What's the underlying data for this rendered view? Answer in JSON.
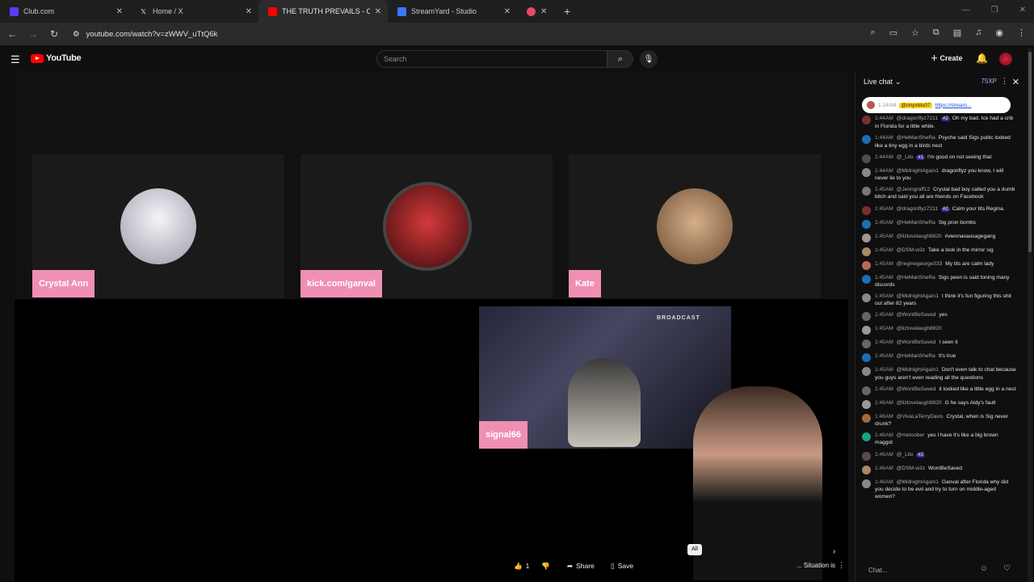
{
  "browser": {
    "tabs": [
      {
        "title": "Club.com",
        "icon_color": "#5b3cff"
      },
      {
        "title": "Home / X",
        "icon_color": "#ffffff"
      },
      {
        "title": "THE TRUTH PREVAILS - CRYSTA",
        "icon_color": "#ff0000"
      },
      {
        "title": "StreamYard - Studio",
        "icon_color": "#3a78ff"
      },
      {
        "title": "",
        "icon_color": "#e04a6a"
      }
    ],
    "url": "youtube.com/watch?v=zWWV_uTtQ6k"
  },
  "youtube": {
    "logo_text": "YouTube",
    "search_placeholder": "Search",
    "create_label": "Create"
  },
  "stream": {
    "participants": [
      {
        "name": "Crystal Ann",
        "avatar_color": "#d8d8e0"
      },
      {
        "name": "kick.com/ganval",
        "avatar_color": "#c0282e"
      },
      {
        "name": "Kate",
        "avatar_color": "#caa37c"
      }
    ],
    "pip_name": "signal66",
    "pip_brand": "BROADCAST",
    "like_count": "1",
    "share_label": "Share",
    "save_label": "Save",
    "chip_label": "All",
    "ticker_text": "... Situation is"
  },
  "chat": {
    "header": "Live chat",
    "xp": "75XP",
    "pinned": {
      "time": "1:24AM",
      "author": "@onyxblu07",
      "text": "https://stream..."
    },
    "input_placeholder": "Chat...",
    "messages": [
      {
        "time": "1:44AM",
        "author": "@dragonflyz7211",
        "badge": "#2",
        "text": "Oh my bad. Ice had a crib in Florida for a little while.",
        "av": "#7a2f2f"
      },
      {
        "time": "1:44AM",
        "author": "@HeManSheRa",
        "badge": "",
        "text": "Psyche said Sigs pubic looked like a tiny egg in a birds nest",
        "av": "#1a6fb5"
      },
      {
        "time": "1:44AM",
        "author": "@_Lilo",
        "badge": "#1",
        "text": "I'm good on not seeing that",
        "av": "#5a4a4a"
      },
      {
        "time": "1:44AM",
        "author": "@MidnightAgain1",
        "badge": "",
        "text": "dragonflyz you know, I will never lie to you",
        "av": "#888888"
      },
      {
        "time": "1:45AM",
        "author": "@Jenngraff12",
        "badge": "",
        "text": "Crystal bad boy called you a dumb bitch and said you all are friends on Facebook",
        "av": "#777777"
      },
      {
        "time": "1:45AM",
        "author": "@dragonflyz7211",
        "badge": "#2",
        "text": "Calm your tits Regina.",
        "av": "#7a2f2f"
      },
      {
        "time": "1:45AM",
        "author": "@HeManSheRa",
        "badge": "",
        "text": "Sig pron bombs",
        "av": "#1a6fb5"
      },
      {
        "time": "1:45AM",
        "author": "@lizlovelaugh8820",
        "badge": "",
        "text": "#viennasausagegang",
        "av": "#999999"
      },
      {
        "time": "1:45AM",
        "author": "@DSM-w3z",
        "badge": "",
        "text": "Take a look in the mirror sig",
        "av": "#aa8866"
      },
      {
        "time": "1:45AM",
        "author": "@reginegeorge333",
        "badge": "",
        "text": "My tits are calm lady",
        "av": "#b56a55"
      },
      {
        "time": "1:45AM",
        "author": "@HeManSheRa",
        "badge": "",
        "text": "Sigs peen is said toning many discords",
        "av": "#1a6fb5"
      },
      {
        "time": "1:45AM",
        "author": "@MidnightAgain1",
        "badge": "",
        "text": "I think it's fun figuring this shit out after 82 years",
        "av": "#888888"
      },
      {
        "time": "1:45AM",
        "author": "@WontBeSaved",
        "badge": "",
        "text": "yes",
        "av": "#666666"
      },
      {
        "time": "1:45AM",
        "author": "@lizlovelaugh8820",
        "badge": "",
        "text": "",
        "av": "#999999"
      },
      {
        "time": "1:45AM",
        "author": "@WontBeSaved",
        "badge": "",
        "text": "I seen it",
        "av": "#666666"
      },
      {
        "time": "1:45AM",
        "author": "@HeManSheRa",
        "badge": "",
        "text": "It's true",
        "av": "#1a6fb5"
      },
      {
        "time": "1:45AM",
        "author": "@MidnightAgain1",
        "badge": "",
        "text": "Don't even talk to chat because you guys aren't even reading all the questions",
        "av": "#888888"
      },
      {
        "time": "1:45AM",
        "author": "@WontBeSaved",
        "badge": "",
        "text": "it looked like a little egg in a nest",
        "av": "#666666"
      },
      {
        "time": "1:46AM",
        "author": "@lizlovelaugh8820",
        "badge": "",
        "text": "G he says Aldy's fault",
        "av": "#999999"
      },
      {
        "time": "1:46AM",
        "author": "@VivaLaTerryDavis",
        "badge": "",
        "text": "Crystal, when is Sig never drunk?",
        "av": "#a06a40"
      },
      {
        "time": "1:46AM",
        "author": "@metoober",
        "badge": "",
        "text": "yes I have it's like a big brown maggot",
        "av": "#1aa082"
      },
      {
        "time": "1:46AM",
        "author": "@_Lilo",
        "badge": "#2",
        "text": "",
        "av": "#5a4a4a"
      },
      {
        "time": "1:46AM",
        "author": "@DSM-w3z",
        "badge": "",
        "text": "WontBeSaved",
        "av": "#aa8866"
      },
      {
        "time": "1:46AM",
        "author": "@MidnightAgain1",
        "badge": "",
        "text": "Ganval after Florida why did you decide to be evil and try to turn on middle-aged women?",
        "av": "#888888"
      }
    ]
  }
}
